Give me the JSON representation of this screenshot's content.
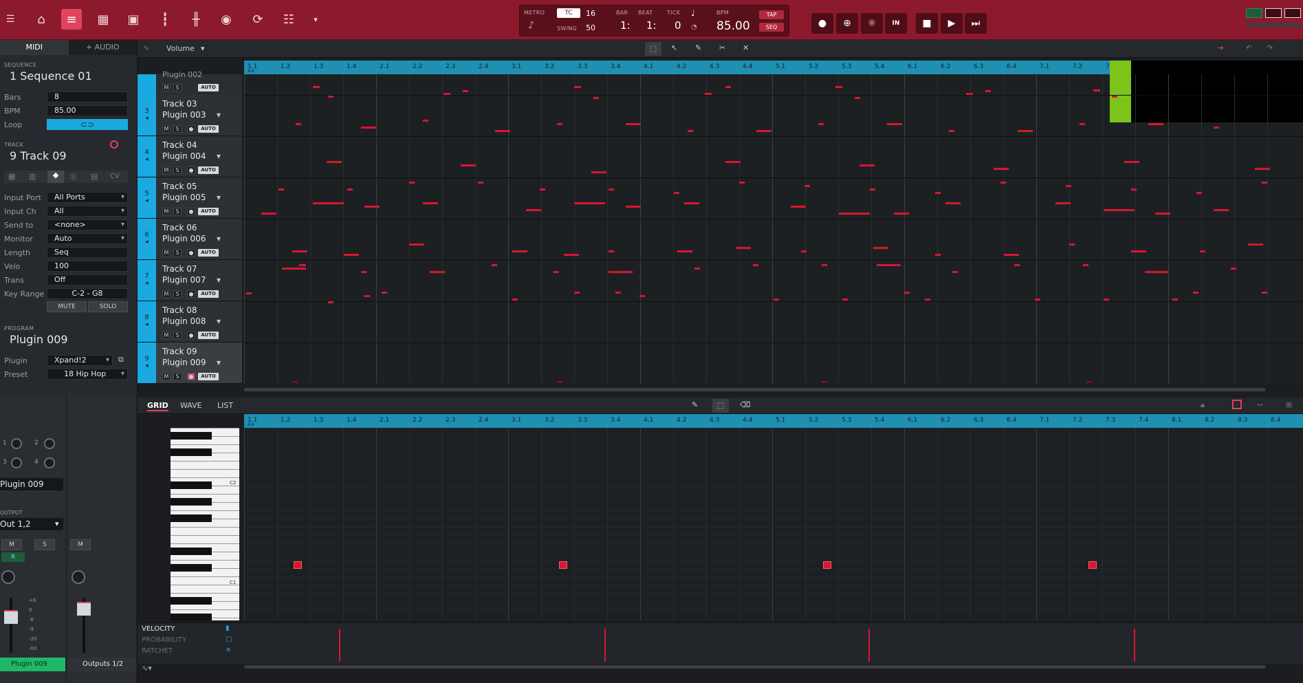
{
  "topbar": {
    "transport": {
      "metro_label": "METRO",
      "tc_label": "TC",
      "tc_value": "16",
      "swing_label": "SWING",
      "swing_value": "50",
      "bar_label": "BAR",
      "bar_value": "1:",
      "beat_label": "BEAT",
      "beat_value": "1:",
      "tick_label": "TICK",
      "tick_value": "0",
      "bpm_label": "BPM",
      "bpm_value": "85.00",
      "tap_label": "TAP",
      "seq_label": "SEQ"
    },
    "in_label": "IN"
  },
  "left_tabs": {
    "midi": "MIDI",
    "audio": "+ AUDIO"
  },
  "sequence": {
    "section": "SEQUENCE",
    "name": "1 Sequence 01",
    "bars_label": "Bars",
    "bars_value": "8",
    "bpm_label": "BPM",
    "bpm_value": "85.00",
    "loop_label": "Loop"
  },
  "track": {
    "section": "TRACK",
    "name": "9 Track 09",
    "cv_label": "CV",
    "props": [
      {
        "label": "Input Port",
        "value": "All Ports"
      },
      {
        "label": "Input Ch",
        "value": "All"
      },
      {
        "label": "Send to",
        "value": "<none>"
      },
      {
        "label": "Monitor",
        "value": "Auto"
      },
      {
        "label": "Length",
        "value": "Seq"
      },
      {
        "label": "Velo",
        "value": "100"
      },
      {
        "label": "Trans",
        "value": "Off"
      },
      {
        "label": "Key Range",
        "value": "C-2 - G8"
      }
    ],
    "mute_label": "MUTE",
    "solo_label": "SOLO"
  },
  "program": {
    "section": "PROGRAM",
    "name": "Plugin 009",
    "plugin_label": "Plugin",
    "plugin_value": "Xpand!2",
    "preset_label": "Preset",
    "preset_value": "18 Hip Hop"
  },
  "seq_toolbar": {
    "volume_label": "Volume"
  },
  "tracks": [
    {
      "num": "3",
      "name": "Track 03",
      "plugin": "Plugin 003"
    },
    {
      "num": "4",
      "name": "Track 04",
      "plugin": "Plugin 004"
    },
    {
      "num": "5",
      "name": "Track 05",
      "plugin": "Plugin 005"
    },
    {
      "num": "6",
      "name": "Track 06",
      "plugin": "Plugin 006"
    },
    {
      "num": "7",
      "name": "Track 07",
      "plugin": "Plugin 007"
    },
    {
      "num": "8",
      "name": "Track 08",
      "plugin": "Plugin 008"
    },
    {
      "num": "9",
      "name": "Track 09",
      "plugin": "Plugin 009"
    }
  ],
  "partial_track_plugin": "Plugin 002",
  "ms": {
    "m": "M",
    "s": "S",
    "auto": "AUTO"
  },
  "ruler_labels": [
    "1.1",
    "1.2",
    "1.3",
    "1.4",
    "2.1",
    "2.2",
    "2.3",
    "2.4",
    "3.1",
    "3.2",
    "3.3",
    "3.4",
    "4.1",
    "4.2",
    "4.3",
    "4.4",
    "5.1",
    "5.2",
    "5.3",
    "5.4",
    "6.1",
    "6.2",
    "6.3",
    "6.4",
    "7.1",
    "7.2",
    "7.3",
    "7.4",
    "8.1",
    "8.2",
    "8.3",
    "8.4"
  ],
  "time_sig": "4/4",
  "grid_tabs": {
    "grid": "GRID",
    "wave": "WAVE",
    "list": "LIST"
  },
  "piano": {
    "c2": "C2",
    "c1": "C1"
  },
  "lanes": {
    "velocity": "VELOCITY",
    "probability": "PROBABILITY",
    "ratchet": "RATCHET"
  },
  "mixer": {
    "plugin_name": "Plugin 009",
    "output_label": "OUTPUT",
    "output_value": "Out 1,2",
    "ch1": "1",
    "ch2": "2",
    "ch3": "3",
    "ch4": "4",
    "m": "M",
    "s": "S",
    "r": "R",
    "scale": [
      "+6",
      "0",
      "-6",
      "-9",
      "-20",
      "-00"
    ],
    "strip1_label": "Plugin 009",
    "strip2_label": "Outputs 1/2"
  }
}
